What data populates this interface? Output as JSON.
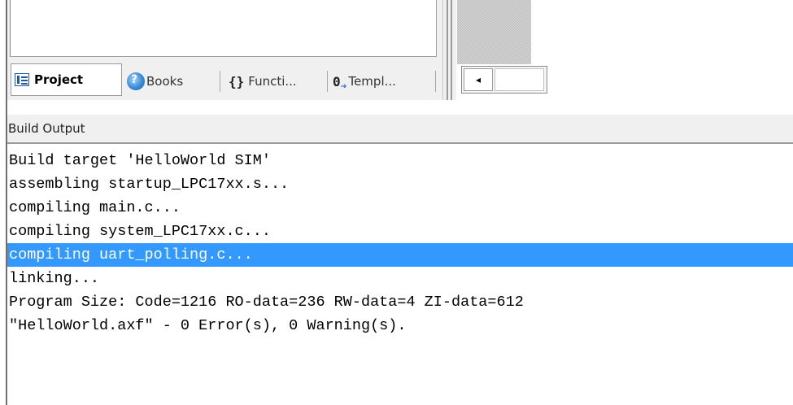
{
  "tabs": [
    {
      "label": "Project",
      "icon": "project-icon",
      "active": true
    },
    {
      "label": "Books",
      "icon": "books-icon",
      "active": false
    },
    {
      "label": "Functi...",
      "icon": "functions-icon",
      "icon_glyph": "{}",
      "active": false
    },
    {
      "label": "Templ...",
      "icon": "templates-icon",
      "icon_glyph": "0",
      "active": false
    }
  ],
  "scrollbar": {
    "left_arrow": "◂"
  },
  "build_output": {
    "title": "Build Output",
    "lines": [
      "Build target 'HelloWorld SIM'",
      "assembling startup_LPC17xx.s...",
      "compiling main.c...",
      "compiling system_LPC17xx.c...",
      "compiling uart_polling.c...",
      "linking...",
      "Program Size: Code=1216 RO-data=236 RW-data=4 ZI-data=612",
      "\"HelloWorld.axf\" - 0 Error(s), 0 Warning(s)."
    ],
    "selected_line_index": 4
  },
  "colors": {
    "selection": "#3399ff",
    "panel_bg": "#f0f0f0",
    "icon_blue": "#1c5aa8"
  }
}
